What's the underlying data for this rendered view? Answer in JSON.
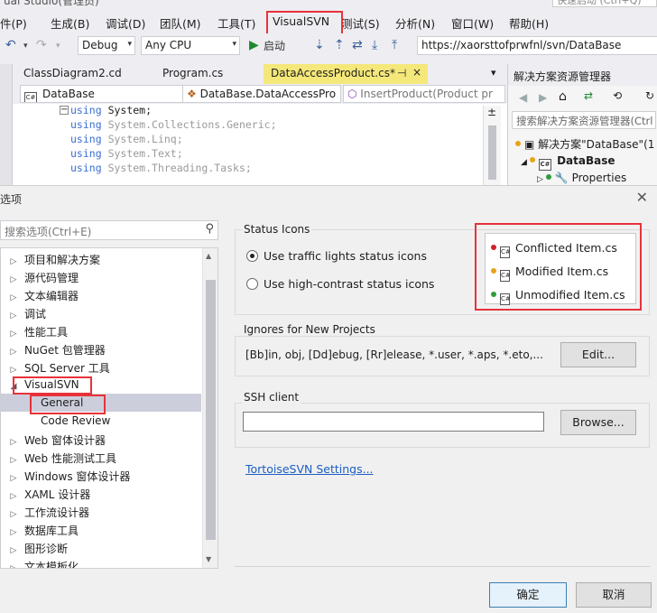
{
  "window": {
    "title_fragment": "ual Studio(管理员)",
    "quick_launch": "快速启动 (Ctrl+Q)"
  },
  "menu": [
    "件(P)",
    "生成(B)",
    "调试(D)",
    "团队(M)",
    "工具(T)",
    "VisualSVN",
    "测试(S)",
    "分析(N)",
    "窗口(W)",
    "帮助(H)"
  ],
  "toolbar": {
    "config": "Debug",
    "platform": "Any CPU",
    "start": "启动",
    "svn_url": "https://xaorsttofprwfnl/svn/DataBase"
  },
  "doc_tabs": [
    {
      "label": "ClassDiagram2.cd"
    },
    {
      "label": "Program.cs"
    },
    {
      "label": "DataAccessProduct.cs*",
      "pin": "⊣",
      "close": "×"
    }
  ],
  "nav": {
    "project": "DataBase",
    "project_badge": "C#",
    "class": "DataBase.DataAccessPro",
    "member": "InsertProduct(Product pr"
  },
  "code_lines": [
    {
      "kw": "using",
      "ns": "System;"
    },
    {
      "kw": "using",
      "ns": "System.Collections.Generic;"
    },
    {
      "kw": "using",
      "ns": "System.Linq;"
    },
    {
      "kw": "using",
      "ns": "System.Text;"
    },
    {
      "kw": "using",
      "ns": "System.Threading.Tasks;"
    }
  ],
  "solution_explorer": {
    "title": "解决方案资源管理器",
    "search": "搜索解决方案资源管理器(Ctrl",
    "solution": "解决方案\"DataBase\"(1",
    "project": "DataBase",
    "project_badge": "C#",
    "properties": "Properties"
  },
  "dialog": {
    "title": "选项",
    "close": "✕",
    "search_placeholder": "搜索选项(Ctrl+E)",
    "tree": [
      {
        "label": "项目和解决方案",
        "expander": "▷"
      },
      {
        "label": "源代码管理",
        "expander": "▷"
      },
      {
        "label": "文本编辑器",
        "expander": "▷"
      },
      {
        "label": "调试",
        "expander": "▷"
      },
      {
        "label": "性能工具",
        "expander": "▷"
      },
      {
        "label": "NuGet 包管理器",
        "expander": "▷"
      },
      {
        "label": "SQL Server 工具",
        "expander": "▷"
      },
      {
        "label": "VisualSVN",
        "expander": "◢"
      },
      {
        "label": "General",
        "child": true,
        "selected": true
      },
      {
        "label": "Code Review",
        "child": true
      },
      {
        "label": "Web 窗体设计器",
        "expander": "▷"
      },
      {
        "label": "Web 性能测试工具",
        "expander": "▷"
      },
      {
        "label": "Windows 窗体设计器",
        "expander": "▷"
      },
      {
        "label": "XAML 设计器",
        "expander": "▷"
      },
      {
        "label": "工作流设计器",
        "expander": "▷"
      },
      {
        "label": "数据库工具",
        "expander": "▷"
      },
      {
        "label": "图形诊断",
        "expander": "▷"
      },
      {
        "label": "文本模板化",
        "expander": "▷"
      }
    ],
    "status_icons": {
      "label": "Status Icons",
      "option_traffic": "Use traffic lights status icons",
      "option_contrast": "Use high-contrast status icons",
      "selected": "traffic",
      "examples": [
        {
          "label": "Conflicted Item.cs",
          "color": "#d0202a"
        },
        {
          "label": "Modified Item.cs",
          "color": "#e8a317"
        },
        {
          "label": "Unmodified Item.cs",
          "color": "#2e9e3a"
        }
      ],
      "file_badge": "C#"
    },
    "ignores": {
      "label": "Ignores for New Projects",
      "value": "[Bb]in, obj, [Dd]ebug, [Rr]elease, *.user, *.aps, *.eto,...",
      "edit_button": "Edit..."
    },
    "ssh": {
      "label": "SSH client",
      "value": "",
      "browse_button": "Browse..."
    },
    "tortoise_link": "TortoiseSVN Settings...",
    "ok_button": "确定",
    "cancel_button": "取消"
  },
  "colors": {
    "highlight": "#e8323a",
    "selected_tab": "#f5e87a",
    "link": "#1a5ec4"
  }
}
